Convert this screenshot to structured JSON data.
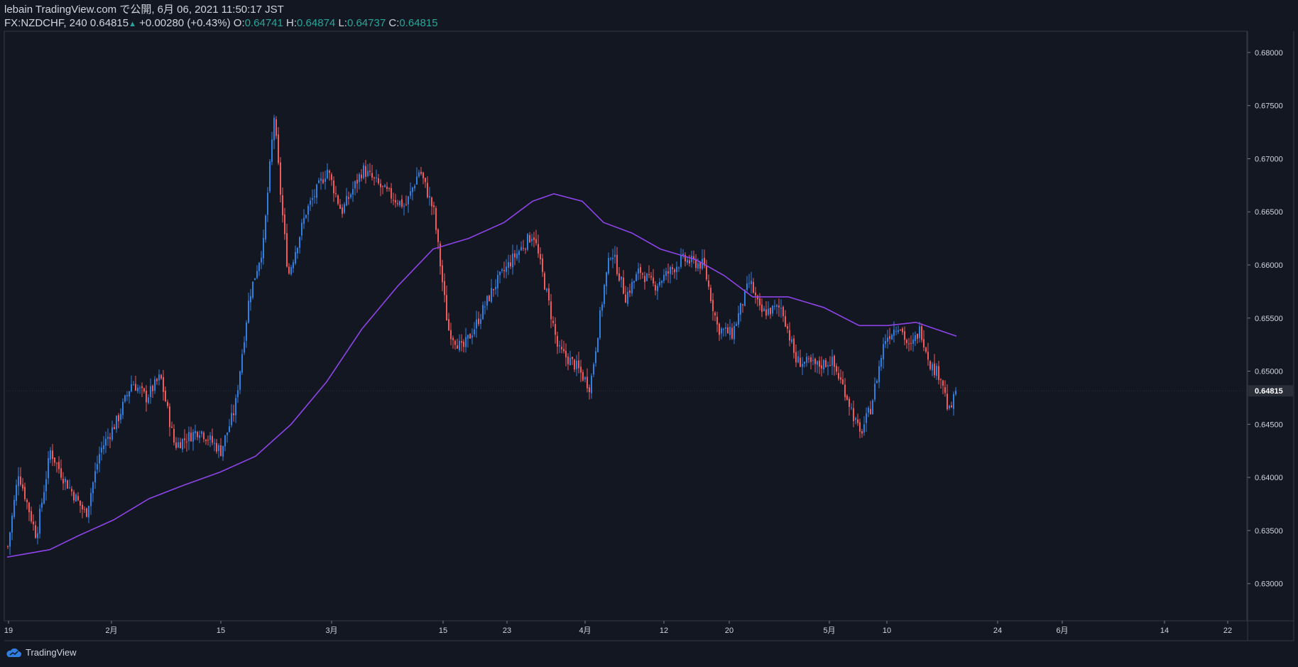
{
  "header": {
    "publish_line": "lebain TradingView.com で公開, 6月 06, 2021 11:50:17 JST",
    "symbol": "FX:NZDCHF, 240",
    "last": "0.64815",
    "change": "+0.00280 (+0.43%)",
    "o_label": "O:",
    "o_value": "0.64741",
    "h_label": "H:",
    "h_value": "0.64874",
    "l_label": "L:",
    "l_value": "0.64737",
    "c_label": "C:",
    "c_value": "0.64815"
  },
  "brand": {
    "name": "TradingView"
  },
  "colors": {
    "bg": "#131722",
    "up": "#2f7fe0",
    "down": "#f05a5a",
    "ma": "#8e44e8",
    "axis_text": "#d1d4dc",
    "price_tag_bg": "#2a2e39"
  },
  "chart_data": {
    "type": "candlestick",
    "symbol": "FX:NZDCHF",
    "timeframe": "240",
    "ylim": [
      0.6265,
      0.682
    ],
    "y_ticks": [
      "0.68000",
      "0.67500",
      "0.67000",
      "0.66500",
      "0.66000",
      "0.65500",
      "0.65000",
      "0.64500",
      "0.64000",
      "0.63500",
      "0.63000"
    ],
    "y_tick_values": [
      0.68,
      0.675,
      0.67,
      0.665,
      0.66,
      0.655,
      0.65,
      0.645,
      0.64,
      0.635,
      0.63
    ],
    "x_ticks": [
      "19",
      "2月",
      "15",
      "3月",
      "15",
      "23",
      "4月",
      "12",
      "20",
      "5月",
      "10",
      "24",
      "6月",
      "14",
      "22"
    ],
    "last_price": 0.64815,
    "last_price_label": "0.64815",
    "close_path": [
      {
        "t": 0,
        "p": 0.6335
      },
      {
        "t": 15,
        "p": 0.6405
      },
      {
        "t": 40,
        "p": 0.6345
      },
      {
        "t": 60,
        "p": 0.6425
      },
      {
        "t": 78,
        "p": 0.64
      },
      {
        "t": 110,
        "p": 0.6365
      },
      {
        "t": 130,
        "p": 0.6425
      },
      {
        "t": 155,
        "p": 0.6455
      },
      {
        "t": 175,
        "p": 0.649
      },
      {
        "t": 195,
        "p": 0.6475
      },
      {
        "t": 215,
        "p": 0.6495
      },
      {
        "t": 235,
        "p": 0.643
      },
      {
        "t": 270,
        "p": 0.6445
      },
      {
        "t": 300,
        "p": 0.6425
      },
      {
        "t": 320,
        "p": 0.6465
      },
      {
        "t": 340,
        "p": 0.657
      },
      {
        "t": 360,
        "p": 0.662
      },
      {
        "t": 375,
        "p": 0.674
      },
      {
        "t": 385,
        "p": 0.666
      },
      {
        "t": 395,
        "p": 0.659
      },
      {
        "t": 420,
        "p": 0.665
      },
      {
        "t": 450,
        "p": 0.669
      },
      {
        "t": 470,
        "p": 0.665
      },
      {
        "t": 500,
        "p": 0.669
      },
      {
        "t": 530,
        "p": 0.667
      },
      {
        "t": 560,
        "p": 0.6655
      },
      {
        "t": 580,
        "p": 0.669
      },
      {
        "t": 600,
        "p": 0.665
      },
      {
        "t": 620,
        "p": 0.654
      },
      {
        "t": 640,
        "p": 0.652
      },
      {
        "t": 660,
        "p": 0.6545
      },
      {
        "t": 685,
        "p": 0.658
      },
      {
        "t": 710,
        "p": 0.6605
      },
      {
        "t": 740,
        "p": 0.663
      },
      {
        "t": 760,
        "p": 0.657
      },
      {
        "t": 775,
        "p": 0.652
      },
      {
        "t": 800,
        "p": 0.6505
      },
      {
        "t": 820,
        "p": 0.6485
      },
      {
        "t": 840,
        "p": 0.658
      },
      {
        "t": 850,
        "p": 0.6615
      },
      {
        "t": 870,
        "p": 0.657
      },
      {
        "t": 890,
        "p": 0.6595
      },
      {
        "t": 910,
        "p": 0.658
      },
      {
        "t": 950,
        "p": 0.6605
      },
      {
        "t": 980,
        "p": 0.66
      },
      {
        "t": 1000,
        "p": 0.654
      },
      {
        "t": 1020,
        "p": 0.6535
      },
      {
        "t": 1045,
        "p": 0.6585
      },
      {
        "t": 1060,
        "p": 0.6555
      },
      {
        "t": 1090,
        "p": 0.656
      },
      {
        "t": 1110,
        "p": 0.651
      },
      {
        "t": 1140,
        "p": 0.6505
      },
      {
        "t": 1160,
        "p": 0.651
      },
      {
        "t": 1180,
        "p": 0.648
      },
      {
        "t": 1200,
        "p": 0.644
      },
      {
        "t": 1215,
        "p": 0.6465
      },
      {
        "t": 1235,
        "p": 0.653
      },
      {
        "t": 1255,
        "p": 0.6545
      },
      {
        "t": 1270,
        "p": 0.652
      },
      {
        "t": 1285,
        "p": 0.654
      },
      {
        "t": 1300,
        "p": 0.6505
      },
      {
        "t": 1315,
        "p": 0.6495
      },
      {
        "t": 1325,
        "p": 0.646
      },
      {
        "t": 1337,
        "p": 0.64815
      }
    ],
    "moving_average": {
      "color": "#8e44e8",
      "points": [
        {
          "t": 0,
          "p": 0.6325
        },
        {
          "t": 60,
          "p": 0.6332
        },
        {
          "t": 100,
          "p": 0.6345
        },
        {
          "t": 150,
          "p": 0.636
        },
        {
          "t": 200,
          "p": 0.638
        },
        {
          "t": 250,
          "p": 0.6393
        },
        {
          "t": 300,
          "p": 0.6405
        },
        {
          "t": 350,
          "p": 0.642
        },
        {
          "t": 400,
          "p": 0.645
        },
        {
          "t": 450,
          "p": 0.649
        },
        {
          "t": 500,
          "p": 0.654
        },
        {
          "t": 550,
          "p": 0.658
        },
        {
          "t": 600,
          "p": 0.6615
        },
        {
          "t": 650,
          "p": 0.6625
        },
        {
          "t": 700,
          "p": 0.664
        },
        {
          "t": 740,
          "p": 0.666
        },
        {
          "t": 770,
          "p": 0.6667
        },
        {
          "t": 810,
          "p": 0.666
        },
        {
          "t": 840,
          "p": 0.664
        },
        {
          "t": 880,
          "p": 0.663
        },
        {
          "t": 920,
          "p": 0.6615
        },
        {
          "t": 970,
          "p": 0.6605
        },
        {
          "t": 1010,
          "p": 0.659
        },
        {
          "t": 1050,
          "p": 0.657
        },
        {
          "t": 1100,
          "p": 0.657
        },
        {
          "t": 1150,
          "p": 0.656
        },
        {
          "t": 1200,
          "p": 0.6543
        },
        {
          "t": 1240,
          "p": 0.6543
        },
        {
          "t": 1280,
          "p": 0.6546
        },
        {
          "t": 1337,
          "p": 0.6533
        }
      ]
    }
  }
}
